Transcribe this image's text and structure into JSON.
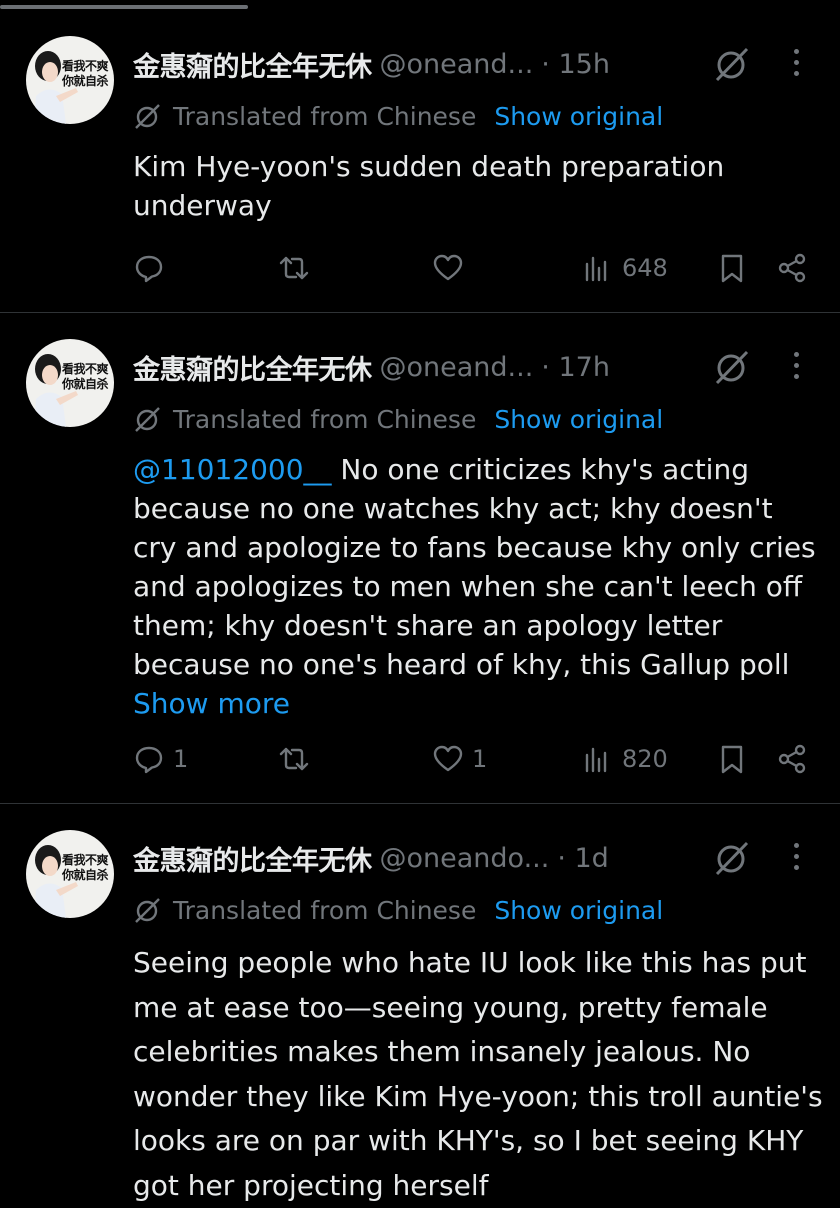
{
  "tweets": [
    {
      "avatar_text": "看我不爽\n你就自杀",
      "name": "金惠奫的比全年无休",
      "handle": "@oneand...",
      "time": "· 15h",
      "translated_label": "Translated from Chinese",
      "show_original": "Show original",
      "mention": "",
      "text": "Kim Hye-yoon's sudden death preparation underway",
      "show_more": "",
      "replies": "",
      "retweets": "",
      "likes": "",
      "views": "648"
    },
    {
      "avatar_text": "看我不爽\n你就自杀",
      "name": "金惠奫的比全年无休",
      "handle": "@oneand...",
      "time": "· 17h",
      "translated_label": "Translated from Chinese",
      "show_original": "Show original",
      "mention": "@11012000__",
      "text": " No one criticizes khy's acting because no one watches khy act; khy doesn't cry and apologize to fans because khy only cries and apologizes to men when she can't leech off them; khy doesn't share an apology letter because no one's heard of khy, this Gallup poll ",
      "show_more": "Show more",
      "replies": "1",
      "retweets": "",
      "likes": "1",
      "views": "820"
    },
    {
      "avatar_text": "看我不爽\n你就自杀",
      "name": "金惠奫的比全年无休",
      "handle": "@oneando...",
      "time": "· 1d",
      "translated_label": "Translated from Chinese",
      "show_original": "Show original",
      "mention": "",
      "text": "Seeing people who hate IU look like this has put me at ease too—seeing young, pretty female celebrities makes them insanely jealous. No wonder they like Kim Hye-yoon; this troll auntie's looks are on par with KHY's, so I bet seeing KHY got her projecting herself",
      "show_more": "",
      "replies": "",
      "retweets": "",
      "likes": "",
      "views": ""
    }
  ],
  "colors": {
    "background": "#000000",
    "text": "#e7e9ea",
    "secondary": "#71767b",
    "link": "#1d9bf0",
    "divider": "#2f3336"
  },
  "icons": [
    "reply-icon",
    "retweet-icon",
    "like-icon",
    "views-icon",
    "bookmark-icon",
    "share-icon",
    "grok-icon",
    "more-icon",
    "translate-icon"
  ]
}
